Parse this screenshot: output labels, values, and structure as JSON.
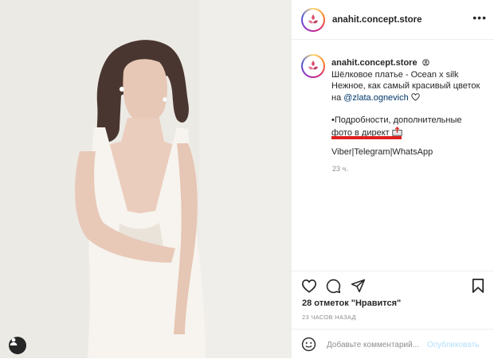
{
  "header": {
    "username": "anahit.concept.store",
    "more": "•••"
  },
  "caption": {
    "username": "anahit.concept.store",
    "line1": "Шёлковое платье - Ocean x silk",
    "line2": "Нежное, как самый красивый цветок",
    "line3_prefix": "на ",
    "mention": "@zlata.ognevich",
    "line4": "•Подробности, дополнительные",
    "line5": "фото в директ",
    "line6": "Viber|Telegram|WhatsApp",
    "time": "23 ч."
  },
  "actions": {
    "likes": "28 отметок \"Нравится\"",
    "ago": "23 ЧАСОВ НАЗАД"
  },
  "comment": {
    "placeholder": "Добавьте комментарий...",
    "post": "Опубликовать"
  },
  "colors": {
    "link": "#00376b",
    "muted": "#8e8e8e",
    "post_disabled": "#b2dffc",
    "redact": "#e02020"
  }
}
